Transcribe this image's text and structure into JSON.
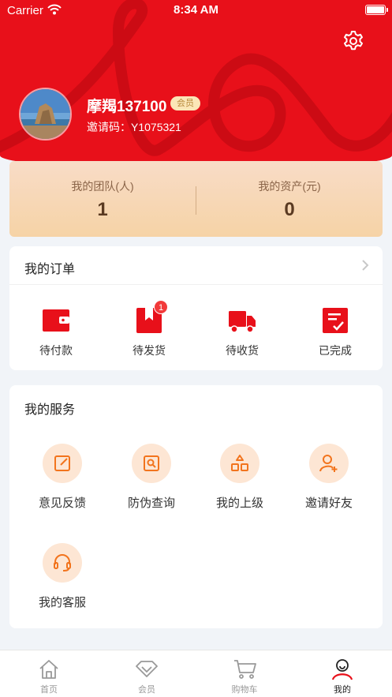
{
  "status_bar": {
    "carrier": "Carrier",
    "time": "8:34 AM"
  },
  "profile": {
    "name": "摩羯137100",
    "member_tag": "会员",
    "invite_code": "邀请码：Y1075321"
  },
  "stats": [
    {
      "label": "我的团队(人)",
      "value": "1"
    },
    {
      "label": "我的资产(元)",
      "value": "0"
    }
  ],
  "orders": {
    "title": "我的订单",
    "items": [
      {
        "label": "待付款",
        "icon": "wallet-icon"
      },
      {
        "label": "待发货",
        "icon": "bookmark-box-icon",
        "badge": "1"
      },
      {
        "label": "待收货",
        "icon": "truck-icon"
      },
      {
        "label": "已完成",
        "icon": "checklist-icon"
      }
    ]
  },
  "services": {
    "title": "我的服务",
    "items": [
      {
        "label": "意见反馈",
        "icon": "edit-icon"
      },
      {
        "label": "防伪查询",
        "icon": "search-document-icon"
      },
      {
        "label": "我的上级",
        "icon": "hierarchy-icon"
      },
      {
        "label": "邀请好友",
        "icon": "add-user-icon"
      },
      {
        "label": "我的客服",
        "icon": "headset-icon"
      }
    ]
  },
  "tabs": [
    {
      "label": "首页",
      "icon": "home-icon"
    },
    {
      "label": "会员",
      "icon": "diamond-icon"
    },
    {
      "label": "购物车",
      "icon": "cart-icon"
    },
    {
      "label": "我的",
      "icon": "user-icon",
      "active": true
    }
  ],
  "colors": {
    "brand_red": "#e8101a",
    "service_orange": "#f2741d",
    "icon_bg": "#fde6d4",
    "stats_gold": "#f6d3a6"
  }
}
